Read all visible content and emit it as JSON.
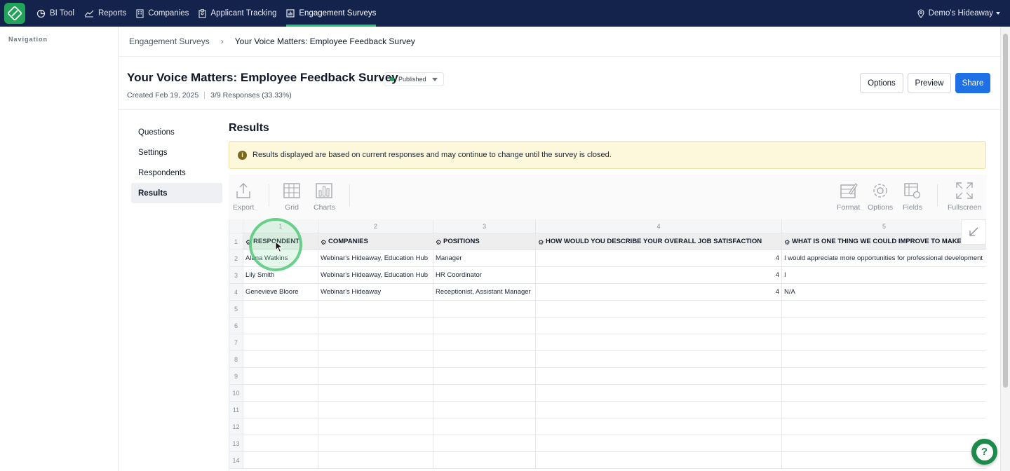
{
  "topnav": {
    "items": [
      {
        "label": "BI Tool",
        "icon": "pie-chart-icon"
      },
      {
        "label": "Reports",
        "icon": "line-chart-icon"
      },
      {
        "label": "Companies",
        "icon": "building-icon"
      },
      {
        "label": "Applicant Tracking",
        "icon": "clipboard-icon"
      },
      {
        "label": "Engagement Surveys",
        "icon": "bar-chart-icon",
        "active": true
      }
    ],
    "location": "Demo's Hideaway"
  },
  "leftrail": {
    "title": "Navigation"
  },
  "breadcrumb": {
    "parent": "Engagement Surveys",
    "current": "Your Voice Matters: Employee Feedback Survey"
  },
  "survey": {
    "title": "Your Voice Matters: Employee Feedback Survey",
    "status": "Published",
    "created": "Created Feb 19, 2025",
    "responses": "3/9 Responses (33.33%)"
  },
  "actions": {
    "options": "Options",
    "preview": "Preview",
    "share": "Share"
  },
  "subnav": {
    "items": [
      "Questions",
      "Settings",
      "Respondents",
      "Results"
    ],
    "active": "Results"
  },
  "results": {
    "title": "Results",
    "notice": "Results displayed are based on current responses and may continue to change until the survey is closed."
  },
  "toolbar": {
    "export": "Export",
    "grid": "Grid",
    "charts": "Charts",
    "format": "Format",
    "options": "Options",
    "fields": "Fields",
    "fullscreen": "Fullscreen"
  },
  "grid": {
    "column_numbers": [
      "1",
      "2",
      "3",
      "4",
      "5"
    ],
    "headers": [
      "RESPONDENT",
      "COMPANIES",
      "POSITIONS",
      "HOW WOULD YOU DESCRIBE YOUR OVERALL JOB SATISFACTION",
      "WHAT IS ONE THING WE COULD IMPROVE TO MAKE"
    ],
    "rows": [
      [
        "Alana Watkins",
        "Webinar's Hideaway, Education Hub",
        "Manager",
        "4",
        "I would appreciate more opportunities for professional development"
      ],
      [
        "Lily Smith",
        "Webinar's Hideaway, Education Hub",
        "HR Coordinator",
        "4",
        "I"
      ],
      [
        "Genevieve Bloore",
        "Webinar's Hideaway",
        "Receptionist, Assistant Manager",
        "4",
        "N/A"
      ]
    ],
    "row_numbers": [
      "1",
      "2",
      "3",
      "4",
      "5",
      "6",
      "7",
      "8",
      "9",
      "10",
      "11",
      "12",
      "13",
      "14"
    ]
  },
  "colors": {
    "topbar": "#13234b",
    "accent_green": "#22c36b",
    "primary_button": "#1f6fe5",
    "notice_bg": "#fdf8dc"
  }
}
